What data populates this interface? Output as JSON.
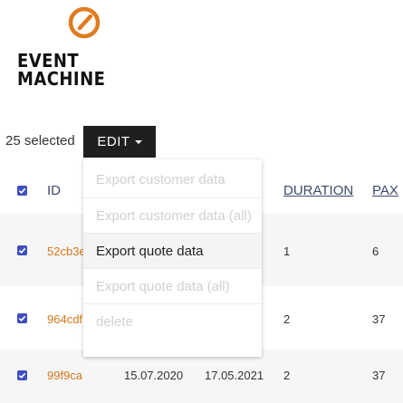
{
  "logo": {
    "line1": "EVENT",
    "line2": "MACHINE"
  },
  "toolbar": {
    "selected_text": "25 selected",
    "edit_label": "EDIT"
  },
  "table": {
    "columns": {
      "id": "ID",
      "duration": "DURATION",
      "pax": "PAX"
    },
    "rows": [
      {
        "id": "52cb3e",
        "date1": "",
        "date2": "",
        "duration": "1",
        "pax": "6",
        "checked": true
      },
      {
        "id": "964cdf",
        "date1": "",
        "date2": "",
        "duration": "2",
        "pax": "37",
        "checked": true
      },
      {
        "id": "99f9ca",
        "date1": "15.07.2020",
        "date2": "17.05.2021",
        "duration": "2",
        "pax": "37",
        "checked": true
      }
    ]
  },
  "dropdown": {
    "items": [
      {
        "label": "Export customer data",
        "enabled": false
      },
      {
        "label": "Export customer data (all)",
        "enabled": false
      },
      {
        "label": "Export quote data",
        "enabled": true
      },
      {
        "label": "Export quote data (all)",
        "enabled": false
      },
      {
        "label": "delete",
        "enabled": false
      }
    ]
  },
  "colors": {
    "accent": "#d7781a",
    "checkbox": "#3f4fbf",
    "button": "#1f1f1f",
    "header_text": "#3d4a6b"
  },
  "icons": {
    "logo": "power-slash-icon",
    "checkbox": "check-icon",
    "caret": "caret-down-icon"
  }
}
